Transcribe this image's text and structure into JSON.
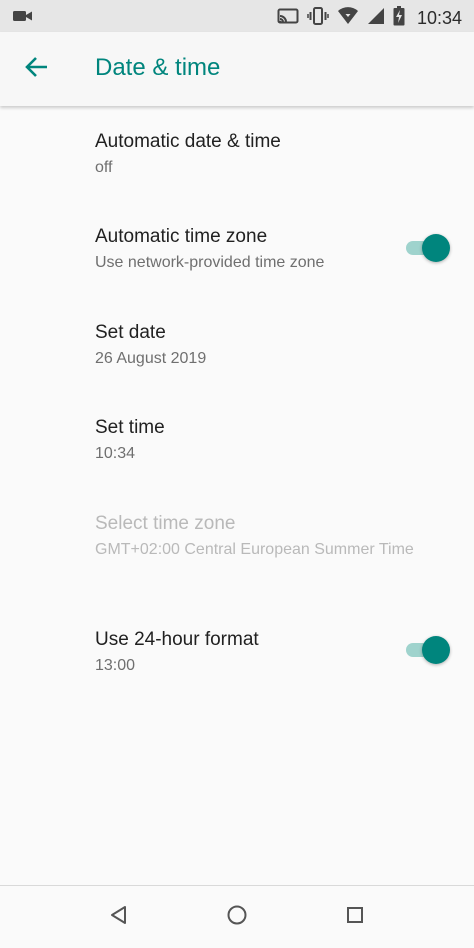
{
  "status_bar": {
    "time": "10:34",
    "icons": [
      "video-camera-icon",
      "cast-icon",
      "vibrate-icon",
      "wifi-icon",
      "cellular-signal-icon",
      "battery-charging-icon"
    ]
  },
  "toolbar": {
    "title": "Date & time",
    "back_icon": "arrow-back-icon"
  },
  "settings": [
    {
      "title": "Automatic date & time",
      "summary": "off",
      "toggle": null,
      "enabled": true
    },
    {
      "title": "Automatic time zone",
      "summary": "Use network-provided time zone",
      "toggle": true,
      "enabled": true
    },
    {
      "title": "Set date",
      "summary": "26 August 2019",
      "toggle": null,
      "enabled": true
    },
    {
      "title": "Set time",
      "summary": "10:34",
      "toggle": null,
      "enabled": true
    },
    {
      "title": "Select time zone",
      "summary": "GMT+02:00 Central European Summer Time",
      "toggle": null,
      "enabled": false
    },
    {
      "title": "Use 24-hour format",
      "summary": "13:00",
      "toggle": true,
      "enabled": true
    }
  ],
  "nav_bar": {
    "buttons": [
      "back-triangle-icon",
      "home-circle-icon",
      "recents-square-icon"
    ]
  },
  "colors": {
    "accent": "#00857d",
    "toggle_track": "#9fd3cd",
    "status_bar_bg": "#e6e6e6",
    "background": "#fafafa",
    "disabled_text": "#b9b9b9"
  }
}
